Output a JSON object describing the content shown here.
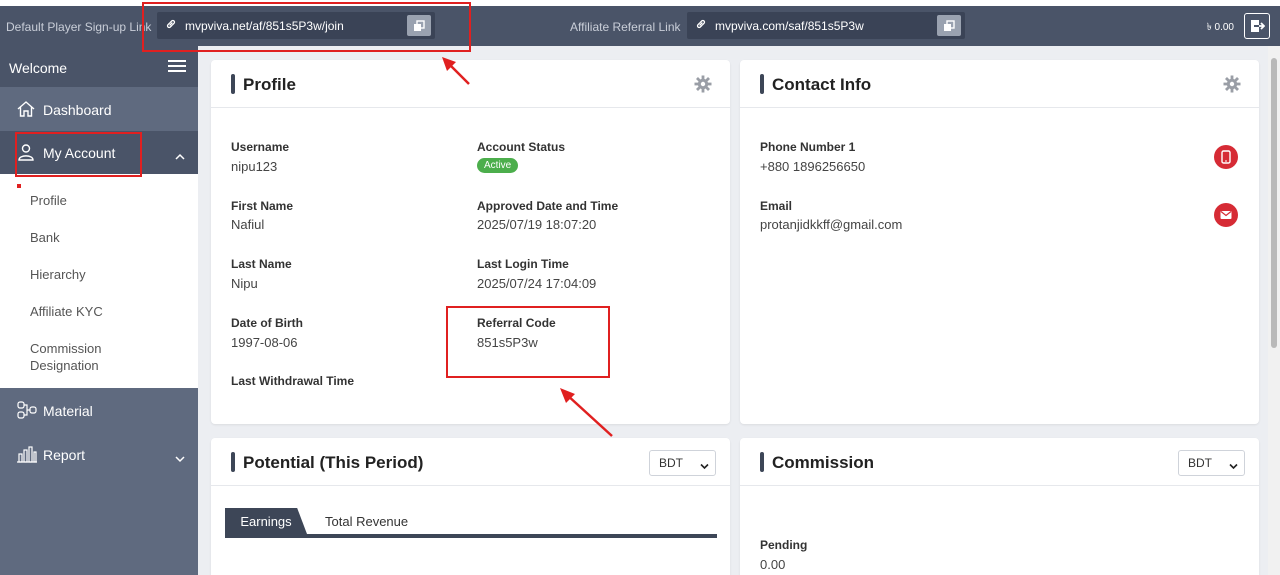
{
  "topbar": {
    "signup_label": "Default Player Sign-up Link",
    "signup_link": "mvpviva.net/af/851s5P3w/join",
    "referral_label": "Affiliate Referral Link",
    "referral_link": "mvpviva.com/saf/851s5P3w",
    "balance": "৳ 0.00"
  },
  "sidebar": {
    "welcome": "Welcome",
    "dashboard": "Dashboard",
    "my_account": "My Account",
    "sub_items": [
      "Profile",
      "Bank",
      "Hierarchy",
      "Affiliate KYC",
      "Commission Designation"
    ],
    "material": "Material",
    "report": "Report"
  },
  "profile": {
    "title": "Profile",
    "username_label": "Username",
    "username": "nipu123",
    "status_label": "Account Status",
    "status": "Active",
    "first_name_label": "First Name",
    "first_name": "Nafiul",
    "approved_label": "Approved Date and Time",
    "approved": "2025/07/19 18:07:20",
    "last_name_label": "Last Name",
    "last_name": "Nipu",
    "last_login_label": "Last Login Time",
    "last_login": "2025/07/24 17:04:09",
    "dob_label": "Date of Birth",
    "dob": "1997-08-06",
    "referral_label": "Referral Code",
    "referral": "851s5P3w",
    "withdrawal_label": "Last Withdrawal Time"
  },
  "contact": {
    "title": "Contact Info",
    "phone_label": "Phone Number 1",
    "phone": "+880 1896256650",
    "email_label": "Email",
    "email": "protanjidkkff@gmail.com"
  },
  "potential": {
    "title": "Potential (This Period)",
    "currency": "BDT",
    "tab_earnings": "Earnings",
    "tab_revenue": "Total Revenue"
  },
  "commission": {
    "title": "Commission",
    "currency": "BDT",
    "pending_label": "Pending",
    "pending": "0.00"
  },
  "colors": {
    "topbar": "#4a5468",
    "sidebar": "#5f6a7f",
    "accent": "#3d4657",
    "active_badge": "#4cae4c",
    "annotation": "#e02020",
    "contact_icon": "#d62b35"
  }
}
